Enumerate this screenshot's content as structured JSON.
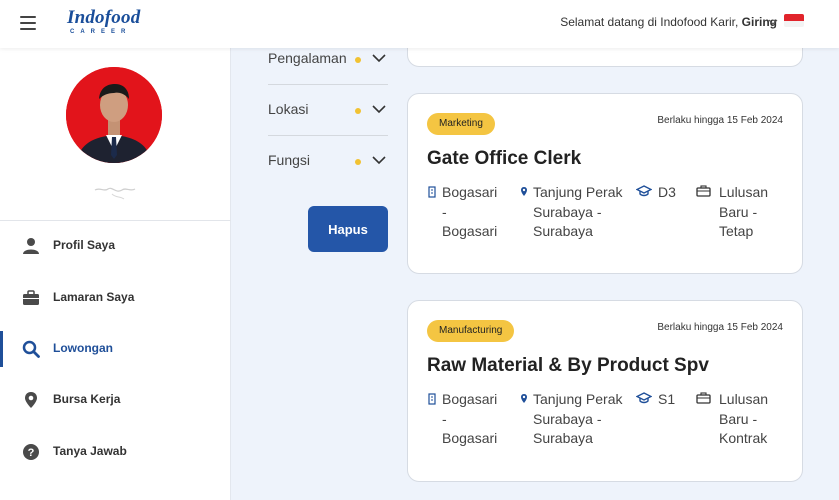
{
  "header": {
    "welcome_prefix": "Selamat datang di Indofood Karir,",
    "user_name": "Giring",
    "logo_main": "Indofood",
    "logo_sub": "CAREER"
  },
  "sidebar": {
    "items": [
      {
        "label": "Profil Saya",
        "icon": "person-icon"
      },
      {
        "label": "Lamaran Saya",
        "icon": "briefcase-icon"
      },
      {
        "label": "Lowongan",
        "icon": "search-icon"
      },
      {
        "label": "Bursa Kerja",
        "icon": "location-pin-icon"
      },
      {
        "label": "Tanya Jawab",
        "icon": "question-icon"
      }
    ]
  },
  "filters": {
    "items": [
      {
        "label": "Pengalaman"
      },
      {
        "label": "Lokasi"
      },
      {
        "label": "Fungsi"
      }
    ],
    "clear_label": "Hapus"
  },
  "jobs": [
    {
      "category": "Marketing",
      "deadline": "Berlaku hingga 15 Feb 2024",
      "title": "Gate Office Clerk",
      "company": [
        "Bogasari",
        "-",
        "Bogasari"
      ],
      "location": [
        "Tanjung Perak",
        "Surabaya -",
        "Surabaya"
      ],
      "education": "D3",
      "type": [
        "Lulusan",
        "Baru -",
        "Tetap"
      ]
    },
    {
      "category": "Manufacturing",
      "deadline": "Berlaku hingga 15 Feb 2024",
      "title": "Raw Material & By Product Spv",
      "company": [
        "Bogasari",
        "-",
        "Bogasari"
      ],
      "location": [
        "Tanjung Perak",
        "Surabaya -",
        "Surabaya"
      ],
      "education": "S1",
      "type": [
        "Lulusan",
        "Baru -",
        "Kontrak"
      ]
    }
  ],
  "colors": {
    "primary": "#2456a8",
    "badge": "#f4c542",
    "avatar_bg": "#e2141b"
  }
}
